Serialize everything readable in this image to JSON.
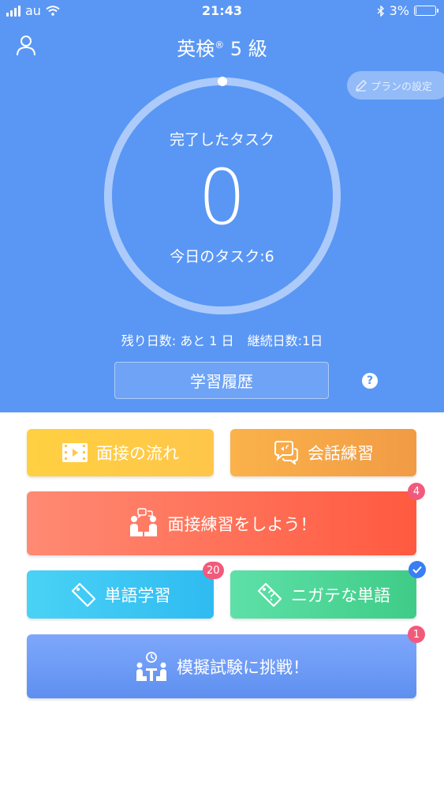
{
  "status_bar": {
    "carrier": "au",
    "time": "21:43",
    "battery": "3%"
  },
  "header": {
    "title": "英検",
    "title_mark": "®",
    "title_level": " 5 級",
    "plan_button": "プランの設定"
  },
  "progress": {
    "label_top": "完了したタスク",
    "completed_count": "0",
    "label_bottom": "今日のタスク:6",
    "days_left": "残り日数: あと 1 日",
    "days_streak": "継続日数:1日"
  },
  "history_button": "学習履歴",
  "help_icon_label": "?",
  "menu": {
    "interview_flow": "面接の流れ",
    "conversation_practice": "会話練習",
    "interview_practice": "面接練習をしよう！",
    "interview_practice_badge": "4",
    "vocab_study": "単語学習",
    "vocab_study_badge": "20",
    "weak_words": "ニガテな単語",
    "mock_exam": "模擬試験に挑戦！",
    "mock_exam_badge": "1"
  },
  "colors": {
    "header_bg": "#5a97f4",
    "badge": "#f25a7b",
    "check_badge": "#3a7ef5"
  },
  "icons": {
    "user": "user-icon",
    "pencil": "pencil-icon",
    "film": "film-icon",
    "chat": "chat-icon",
    "people": "people-icon",
    "tag": "tag-icon",
    "tag_question": "tag-question-icon",
    "exam": "exam-icon",
    "check": "check-icon"
  }
}
